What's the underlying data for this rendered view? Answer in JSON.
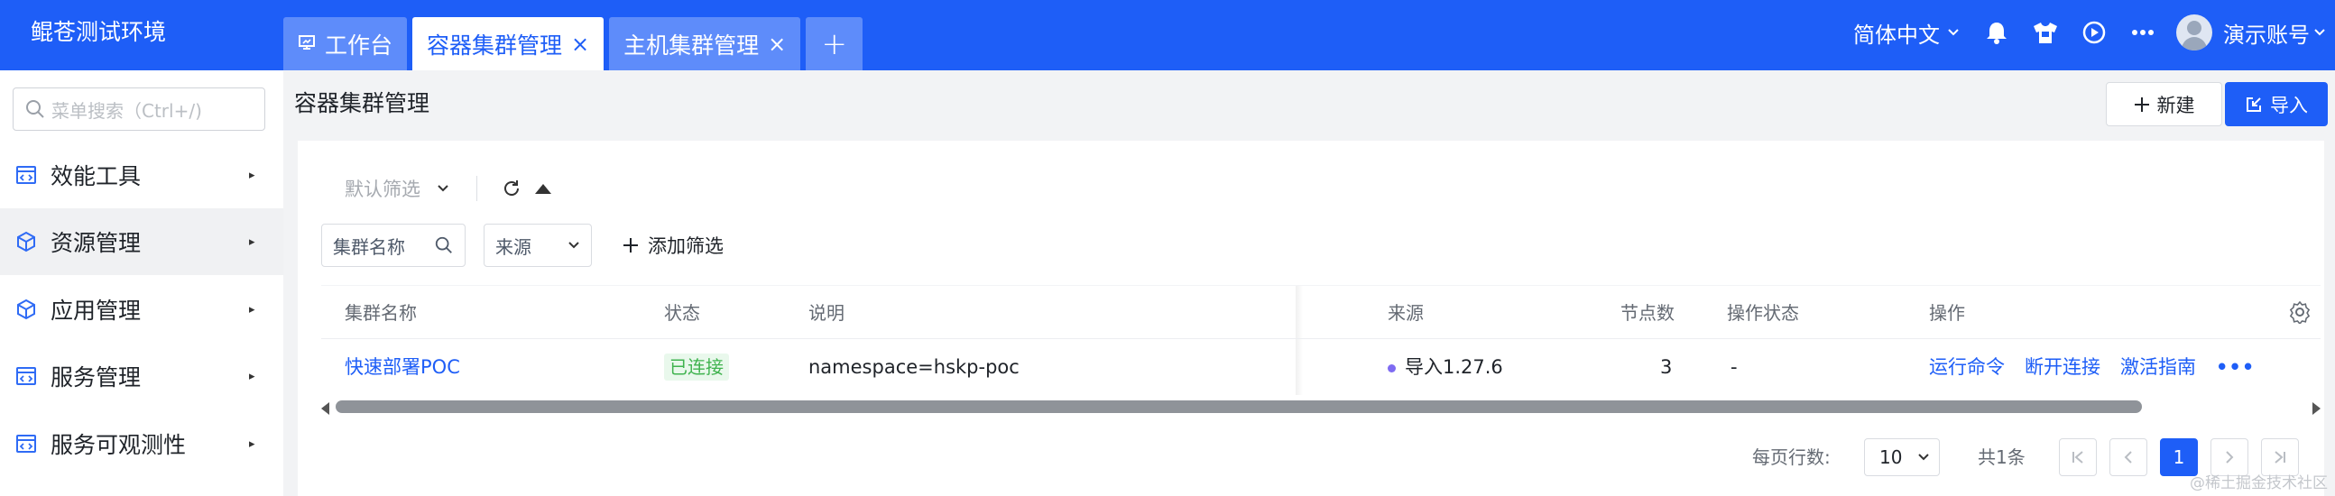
{
  "app": {
    "title": "鲲苍测试环境"
  },
  "tabs": [
    {
      "label": "工作台",
      "icon": "monitor-icon",
      "closable": false,
      "active": false
    },
    {
      "label": "容器集群管理",
      "closable": true,
      "active": true
    },
    {
      "label": "主机集群管理",
      "closable": true,
      "active": false
    }
  ],
  "tab_close_glyph": "×",
  "tab_add_glyph": "+",
  "header": {
    "language": "简体中文",
    "username": "演示账号",
    "icons": [
      "bell-icon",
      "shirt-icon",
      "play-circle-icon",
      "more-icon"
    ]
  },
  "sidebar": {
    "search_placeholder": "菜单搜索（Ctrl+/)",
    "items": [
      {
        "label": "效能工具",
        "icon": "code-window-icon",
        "active": false
      },
      {
        "label": "资源管理",
        "icon": "cube-icon",
        "active": true
      },
      {
        "label": "应用管理",
        "icon": "cube-icon",
        "active": false
      },
      {
        "label": "服务管理",
        "icon": "code-window-icon",
        "active": false
      },
      {
        "label": "服务可观测性",
        "icon": "code-window-icon",
        "active": false
      }
    ],
    "arrow_glyph": "▸"
  },
  "page": {
    "title": "容器集群管理",
    "new_button": "新建",
    "import_button": "导入"
  },
  "filters": {
    "default_filter": "默认筛选",
    "cluster_name": "集群名称",
    "source": "来源",
    "add_filter": "添加筛选"
  },
  "table": {
    "columns": [
      "集群名称",
      "状态",
      "说明",
      "来源",
      "节点数",
      "操作状态",
      "操作"
    ],
    "rows": [
      {
        "name": "快速部署POC",
        "status": "已连接",
        "description": "namespace=hskp-poc",
        "source": "导入1.27.6",
        "nodes": "3",
        "op_status": "-",
        "actions": [
          "运行命令",
          "断开连接",
          "激活指南"
        ],
        "more": "•••"
      }
    ]
  },
  "pagination": {
    "per_page_label": "每页行数:",
    "per_page": "10",
    "total": "共1条",
    "current_page": "1"
  },
  "watermark": "@稀土掘金技术社区",
  "colors": {
    "primary": "#1e5ef7",
    "success": "#40b34f",
    "source_dot": "#7e6bf2"
  }
}
